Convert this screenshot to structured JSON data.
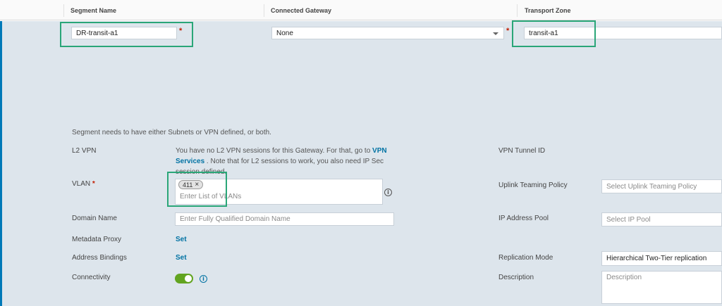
{
  "header": {
    "segment_name": "Segment Name",
    "connected_gateway": "Connected Gateway",
    "transport_zone": "Transport Zone"
  },
  "segment_name": {
    "value": "DR-transit-a1"
  },
  "connected_gateway": {
    "value": "None"
  },
  "transport_zone": {
    "value": "transit-a1"
  },
  "required_mark": "*",
  "notice": "Segment needs to have either Subnets or VPN defined, or both.",
  "l2vpn": {
    "label": "L2 VPN",
    "text_part1": "You have no L2 VPN sessions for this Gateway. For that, go to ",
    "link_text": "VPN Services",
    "text_part2": " . Note that for L2 sessions to work, you also need IP Sec session defined."
  },
  "vpn_tunnel_id": {
    "label": "VPN Tunnel ID"
  },
  "vlan": {
    "label": "VLAN",
    "chip": "411",
    "chip_close": "×",
    "placeholder": "Enter List of VLANs"
  },
  "uplink_teaming": {
    "label": "Uplink Teaming Policy",
    "placeholder": "Select Uplink Teaming Policy"
  },
  "domain_name": {
    "label": "Domain Name",
    "placeholder": "Enter Fully Qualified Domain Name"
  },
  "ip_pool": {
    "label": "IP Address Pool",
    "placeholder": "Select IP Pool"
  },
  "metadata_proxy": {
    "label": "Metadata Proxy",
    "action": "Set"
  },
  "address_bindings": {
    "label": "Address Bindings",
    "action": "Set"
  },
  "replication": {
    "label": "Replication Mode",
    "value": "Hierarchical Two-Tier replication"
  },
  "connectivity": {
    "label": "Connectivity",
    "state": "on"
  },
  "description": {
    "label": "Description",
    "placeholder": "Description"
  },
  "icons": {
    "info": "info-icon",
    "dropdown": "chevron-down-icon",
    "toggle": "toggle-switch"
  },
  "colors": {
    "accent": "#0079b8",
    "highlight": "#2aa678",
    "toggle_on": "#62a420",
    "required": "#c21d00",
    "link": "#0072a3"
  }
}
